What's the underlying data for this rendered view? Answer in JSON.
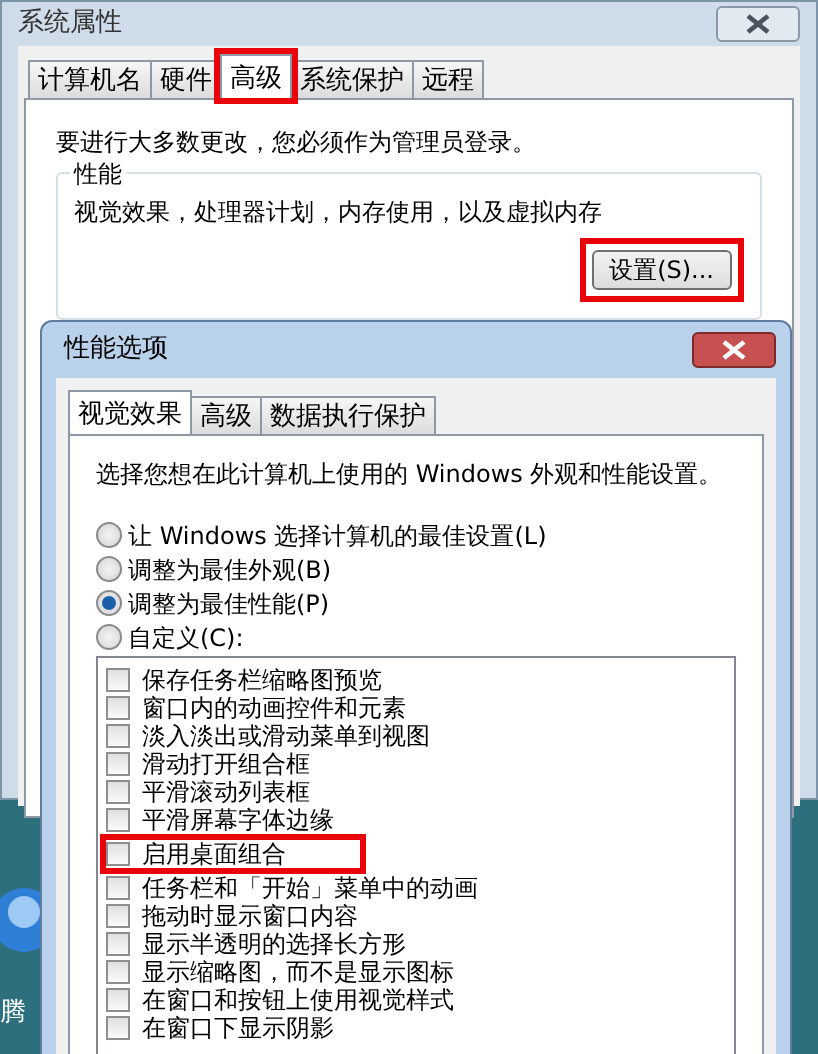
{
  "window": {
    "title": "系统属性"
  },
  "tabs": [
    {
      "label": "计算机名",
      "selected": false,
      "highlighted": false
    },
    {
      "label": "硬件",
      "selected": false,
      "highlighted": false
    },
    {
      "label": "高级",
      "selected": true,
      "highlighted": true
    },
    {
      "label": "系统保护",
      "selected": false,
      "highlighted": false
    },
    {
      "label": "远程",
      "selected": false,
      "highlighted": false
    }
  ],
  "notice": "要进行大多数更改，您必须作为管理员登录。",
  "performance": {
    "title": "性能",
    "description": "视觉效果，处理器计划，内存使用，以及虚拟内存",
    "settings_button": {
      "label": "设置(S)...",
      "highlighted": true
    }
  },
  "dialog": {
    "title": "性能选项",
    "tabs": [
      {
        "label": "视觉效果",
        "selected": true
      },
      {
        "label": "高级",
        "selected": false
      },
      {
        "label": "数据执行保护",
        "selected": false
      }
    ],
    "description": "选择您想在此计算机上使用的 Windows 外观和性能设置。",
    "radios": [
      {
        "label": "让 Windows 选择计算机的最佳设置(L)",
        "selected": false
      },
      {
        "label": "调整为最佳外观(B)",
        "selected": false
      },
      {
        "label": "调整为最佳性能(P)",
        "selected": true
      },
      {
        "label": "自定义(C):",
        "selected": false
      }
    ],
    "options": [
      {
        "label": "保存任务栏缩略图预览",
        "checked": false,
        "highlighted": false
      },
      {
        "label": "窗口内的动画控件和元素",
        "checked": false,
        "highlighted": false
      },
      {
        "label": "淡入淡出或滑动菜单到视图",
        "checked": false,
        "highlighted": false
      },
      {
        "label": "滑动打开组合框",
        "checked": false,
        "highlighted": false
      },
      {
        "label": "平滑滚动列表框",
        "checked": false,
        "highlighted": false
      },
      {
        "label": "平滑屏幕字体边缘",
        "checked": false,
        "highlighted": false
      },
      {
        "label": "启用桌面组合",
        "checked": false,
        "highlighted": true
      },
      {
        "label": "任务栏和「开始」菜单中的动画",
        "checked": false,
        "highlighted": false
      },
      {
        "label": "拖动时显示窗口内容",
        "checked": false,
        "highlighted": false
      },
      {
        "label": "显示半透明的选择长方形",
        "checked": false,
        "highlighted": false
      },
      {
        "label": "显示缩略图，而不是显示图标",
        "checked": false,
        "highlighted": false
      },
      {
        "label": "在窗口和按钮上使用视觉样式",
        "checked": false,
        "highlighted": false
      },
      {
        "label": "在窗口下显示阴影",
        "checked": false,
        "highlighted": false
      }
    ]
  },
  "desktop": {
    "icon_label": "腾"
  }
}
